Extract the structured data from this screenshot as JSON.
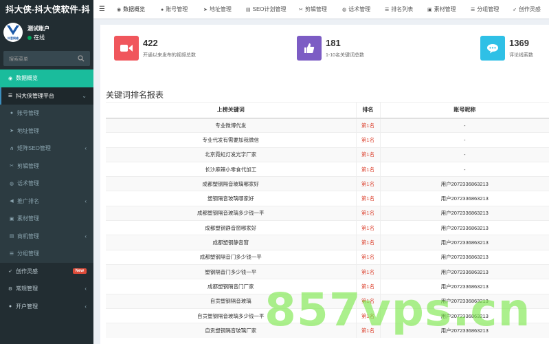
{
  "sidebar": {
    "brand": "抖大侠-抖大侠软件-抖",
    "avatar_caption": "抖音网络",
    "user_name": "测试账户",
    "user_status": "在线",
    "search_placeholder": "搜索菜单",
    "items": [
      {
        "label": "数据概览",
        "icon": "dashboard-icon"
      },
      {
        "label": "抖大侠管理平台",
        "icon": "list-icon"
      },
      {
        "label": "账号管理",
        "icon": "user-icon"
      },
      {
        "label": "地址管理",
        "icon": "location-arrow-icon"
      },
      {
        "label": "矩阵SEO管理",
        "icon": "share-icon"
      },
      {
        "label": "剪辑管理",
        "icon": "scissors-icon"
      },
      {
        "label": "话术管理",
        "icon": "comments-icon"
      },
      {
        "label": "推广排名",
        "icon": "bullhorn-icon"
      },
      {
        "label": "素材管理",
        "icon": "film-icon"
      },
      {
        "label": "商机管理",
        "icon": "briefcase-icon"
      },
      {
        "label": "分组管理",
        "icon": "list-icon"
      },
      {
        "label": "创作灵感",
        "icon": "rocket-icon",
        "badge": "New"
      },
      {
        "label": "常规管理",
        "icon": "cogs-icon"
      },
      {
        "label": "开户管理",
        "icon": "users-icon"
      }
    ]
  },
  "topnav": {
    "tabs": [
      {
        "label": "数据概览",
        "icon": "dashboard-icon"
      },
      {
        "label": "账号管理",
        "icon": "user-icon"
      },
      {
        "label": "地址管理",
        "icon": "location-arrow-icon"
      },
      {
        "label": "SEO计划管理",
        "icon": "list-alt-icon"
      },
      {
        "label": "剪辑管理",
        "icon": "scissors-icon"
      },
      {
        "label": "话术管理",
        "icon": "comments-icon"
      },
      {
        "label": "排名列表",
        "icon": "list-icon"
      },
      {
        "label": "素材管理",
        "icon": "film-icon"
      },
      {
        "label": "分组管理",
        "icon": "list-icon"
      },
      {
        "label": "创作灵感",
        "icon": "rocket-icon"
      }
    ]
  },
  "stats": [
    {
      "value": "422",
      "desc": "开通以来发布的视频总数",
      "color": "#f0565c",
      "icon": "video-camera-icon"
    },
    {
      "value": "181",
      "desc": "1-10名关键词总数",
      "color": "#7c5cc4",
      "icon": "thumbs-up-icon"
    },
    {
      "value": "1369",
      "desc": "评论线索数",
      "color": "#2fc0e6",
      "icon": "comment-icon"
    }
  ],
  "report": {
    "title": "关键词排名报表",
    "columns": [
      "上榜关键词",
      "排名",
      "账号昵称"
    ],
    "rows": [
      [
        "专业微博代发",
        "第1名",
        "-"
      ],
      [
        "专业代发有需要加我微信",
        "第1名",
        "-"
      ],
      [
        "北京霓虹灯发光字厂家",
        "第1名",
        "-"
      ],
      [
        "长沙麻辣小零食代加工",
        "第1名",
        "-"
      ],
      [
        "成都塑钢隔音玻璃哪家好",
        "第1名",
        "用户2072336863213"
      ],
      [
        "塑钢隔音玻璃哪家好",
        "第1名",
        "用户2072336863213"
      ],
      [
        "成都塑钢隔音玻璃多少钱一平",
        "第1名",
        "用户2072336863213"
      ],
      [
        "成都塑钢静音窗哪家好",
        "第1名",
        "用户2072336863213"
      ],
      [
        "成都塑钢静音窗",
        "第1名",
        "用户2072336863213"
      ],
      [
        "成都塑钢隔音门多少钱一平",
        "第1名",
        "用户2072336863213"
      ],
      [
        "塑钢隔音门多少钱一平",
        "第1名",
        "用户2072336863213"
      ],
      [
        "成都塑钢隔音门厂家",
        "第1名",
        "用户2072336863213"
      ],
      [
        "自贡塑钢隔音玻璃",
        "第1名",
        "用户2072336863213"
      ],
      [
        "自贡塑钢隔音玻璃多少钱一平",
        "第1名",
        "用户2072336863213"
      ],
      [
        "自贡塑钢隔音玻璃厂家",
        "第1名",
        "用户2072336863213"
      ]
    ]
  },
  "watermark": "857vps.cn"
}
